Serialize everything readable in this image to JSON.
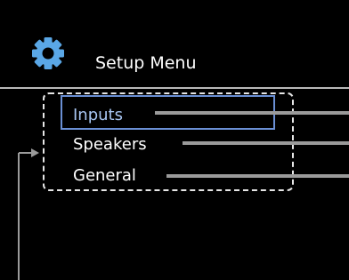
{
  "screen": {
    "title": "Setup Menu",
    "title_icon": "gear-icon",
    "colors": {
      "background": "#000000",
      "text": "#ffffff",
      "selection_border": "#6a8fd4",
      "selected_text": "#a8c6f2",
      "callout_line": "#9a9a9a"
    }
  },
  "menu": {
    "items": [
      {
        "label": "Inputs",
        "selected": true
      },
      {
        "label": "Speakers",
        "selected": false
      },
      {
        "label": "General",
        "selected": false
      }
    ]
  }
}
